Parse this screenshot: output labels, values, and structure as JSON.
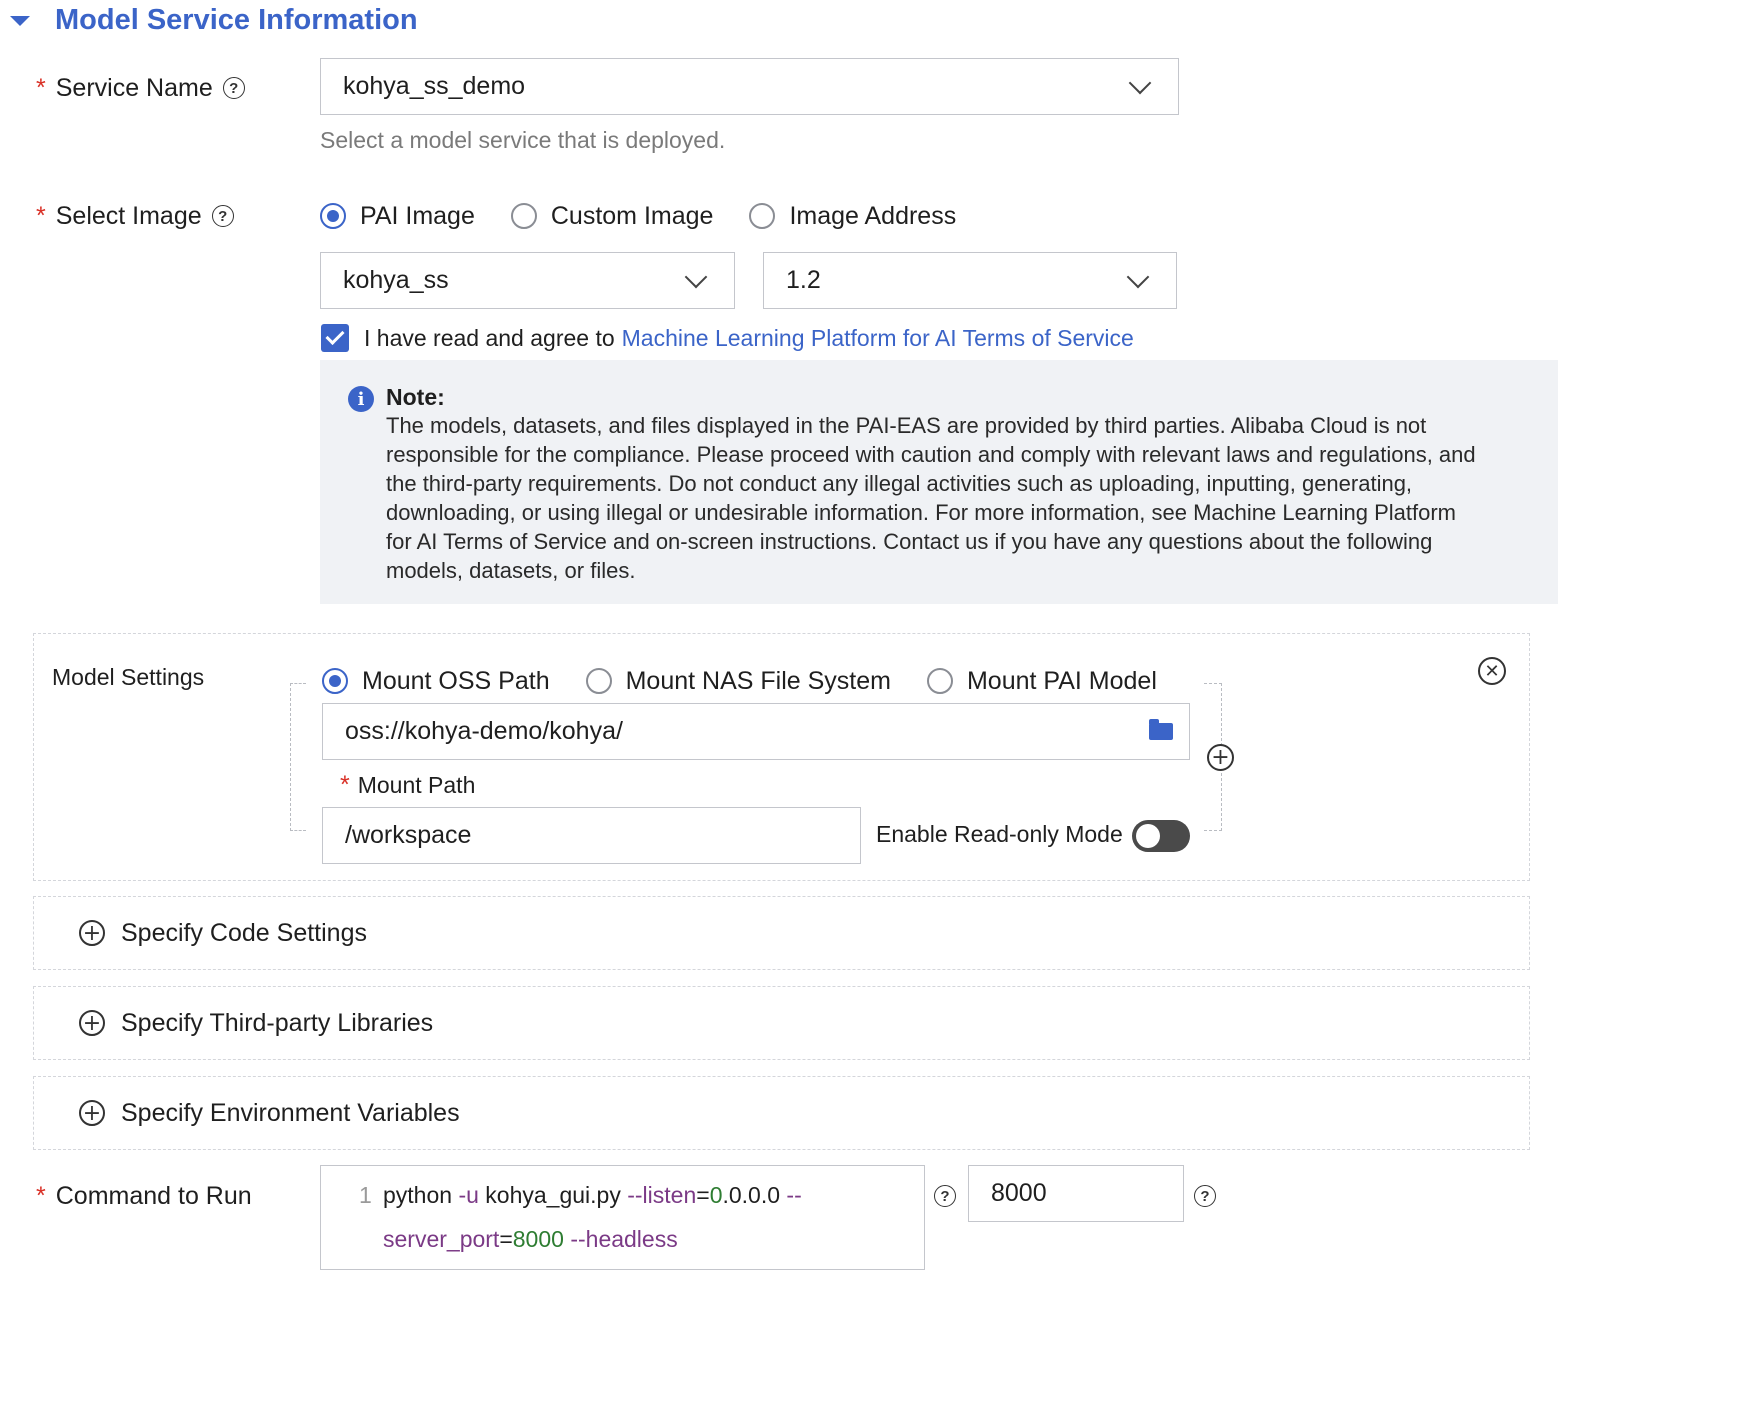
{
  "section": {
    "title": "Model Service Information"
  },
  "service_name": {
    "label": "Service Name",
    "value": "kohya_ss_demo",
    "hint": "Select a model service that is deployed."
  },
  "select_image": {
    "label": "Select Image",
    "options": [
      "PAI Image",
      "Custom Image",
      "Image Address"
    ],
    "selected": "PAI Image",
    "image_value": "kohya_ss",
    "version_value": "1.2"
  },
  "agreement": {
    "checked": true,
    "prefix": "I have read and agree to",
    "link_text": "Machine Learning Platform for AI Terms of Service"
  },
  "note": {
    "title": "Note:",
    "lines": [
      "The models, datasets, and files displayed in the PAI-EAS are provided by third parties. Alibaba Cloud is not",
      "responsible for the compliance. Please proceed with caution and comply with relevant laws and regulations, and",
      "the third-party requirements. Do not conduct any illegal activities such as uploading, inputting, generating,",
      "downloading, or using illegal or undesirable information. For more information, see Machine Learning Platform",
      "for AI Terms of Service and on-screen instructions. Contact us if you have any questions about the following",
      "models, datasets, or files."
    ]
  },
  "model_settings": {
    "label": "Model Settings",
    "options": [
      "Mount OSS Path",
      "Mount NAS File System",
      "Mount PAI Model"
    ],
    "selected": "Mount OSS Path",
    "oss_path": "oss://kohya-demo/kohya/",
    "mount_path_label": "Mount Path",
    "mount_path_value": "/workspace",
    "readonly_label": "Enable Read-only Mode",
    "readonly_enabled": false
  },
  "expanders": [
    {
      "label": "Specify Code Settings"
    },
    {
      "label": "Specify Third-party Libraries"
    },
    {
      "label": "Specify Environment Variables"
    }
  ],
  "command": {
    "label": "Command to Run",
    "line_number": "1",
    "tokens_line1": [
      {
        "t": "python ",
        "k": "plain"
      },
      {
        "t": "-u ",
        "k": "flag"
      },
      {
        "t": "kohya_gui.py ",
        "k": "plain"
      },
      {
        "t": "--listen",
        "k": "flag"
      },
      {
        "t": "=",
        "k": "plain"
      },
      {
        "t": "0",
        "k": "num"
      },
      {
        "t": ".0.0.0 ",
        "k": "plain"
      },
      {
        "t": "--",
        "k": "flag"
      }
    ],
    "tokens_line2": [
      {
        "t": "server_port",
        "k": "flag"
      },
      {
        "t": "=",
        "k": "plain"
      },
      {
        "t": "8000",
        "k": "num"
      },
      {
        "t": " --headless",
        "k": "flag"
      }
    ],
    "port_value": "8000"
  },
  "colors": {
    "accent": "#3b64c8",
    "required": "#d93026",
    "note_bg": "#f0f2f5"
  }
}
